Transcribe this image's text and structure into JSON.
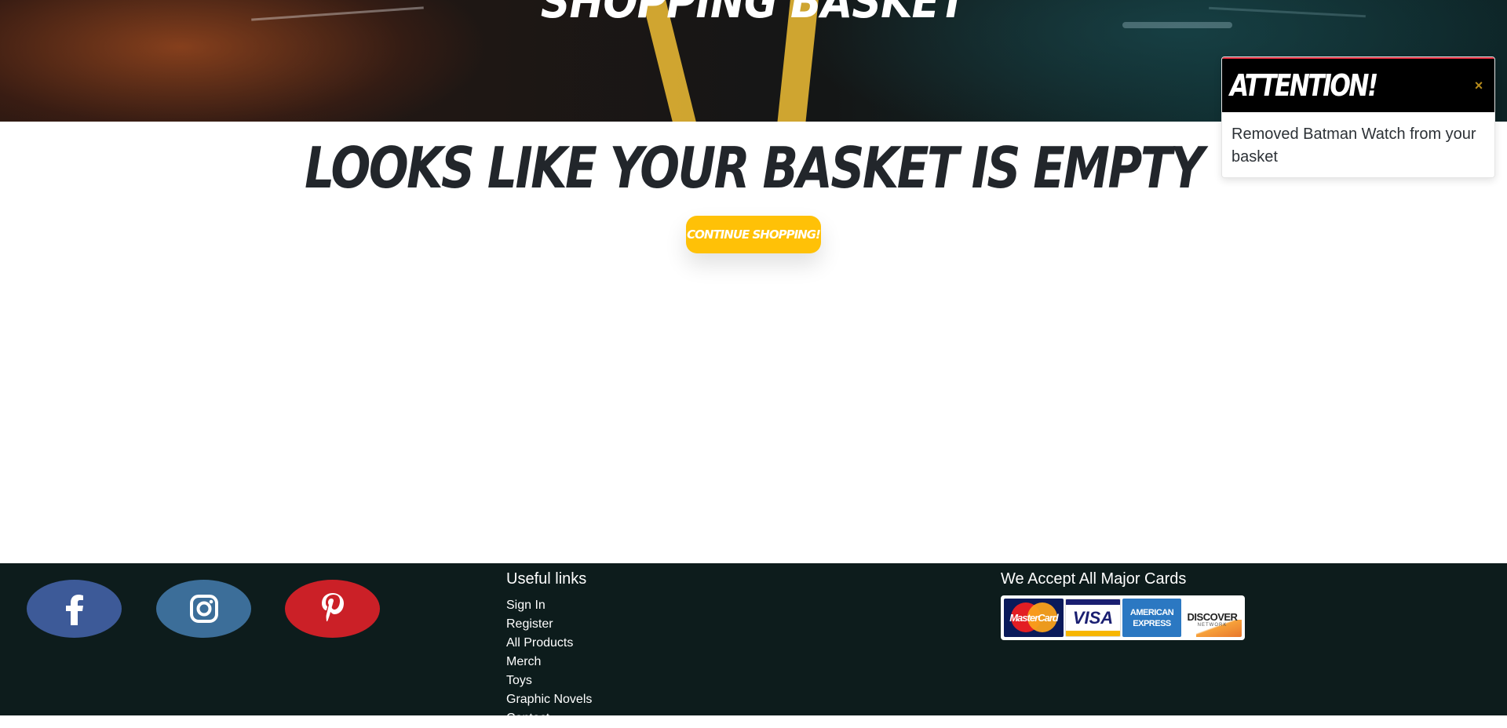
{
  "hero": {
    "title": "Shopping Basket"
  },
  "main": {
    "empty_heading": "Looks like your basket is empty",
    "continue_button": "Continue Shopping!"
  },
  "toast": {
    "title": "Attention!",
    "close_glyph": "×",
    "message": "Removed Batman Watch from your basket",
    "accent_color": "#e02a3c"
  },
  "footer": {
    "social": [
      {
        "name": "facebook",
        "icon": "facebook-icon",
        "color": "#3d5a98"
      },
      {
        "name": "instagram",
        "icon": "instagram-icon",
        "color": "#3c6e99"
      },
      {
        "name": "pinterest",
        "icon": "pinterest-icon",
        "color": "#cb2027"
      }
    ],
    "useful_links": {
      "heading": "Useful links",
      "items": [
        "Sign In",
        "Register",
        "All Products",
        "Merch",
        "Toys",
        "Graphic Novels",
        "Contact"
      ]
    },
    "cards": {
      "heading": "We Accept All Major Cards",
      "mastercard": "MasterCard",
      "visa": "VISA",
      "amex_line1": "AMERICAN",
      "amex_line2": "EXPRESS",
      "discover": "DISCOVER",
      "discover_sub": "NETWORK"
    }
  },
  "colors": {
    "accent": "#ffc107",
    "footer_bg": "#0d1c1c"
  }
}
